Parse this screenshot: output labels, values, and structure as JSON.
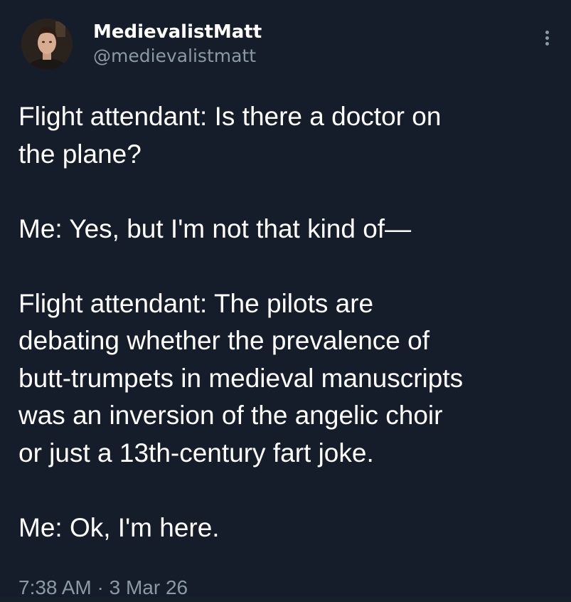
{
  "author": {
    "display_name": "MedievalistMatt",
    "handle": "@medievalistmatt",
    "avatar_icon": "profile-photo"
  },
  "actions": {
    "more_icon": "vertical-ellipsis-icon"
  },
  "tweet": {
    "paragraphs": [
      {
        "lines": [
          "Flight attendant: Is there a doctor on",
          "the plane?"
        ]
      },
      {
        "lines": [
          "Me: Yes, but I'm not that kind of—"
        ]
      },
      {
        "lines": [
          "Flight attendant: The pilots are",
          "debating whether the prevalence of",
          "butt-trumpets in medieval manuscripts",
          "was an inversion of the angelic choir",
          "or just a 13th-century fart joke."
        ]
      },
      {
        "lines": [
          "Me: Ok, I'm here."
        ]
      }
    ],
    "time": "7:38 AM",
    "separator": "·",
    "date": "3 Mar 26"
  },
  "colors": {
    "background": "#161d2a",
    "text": "#ffffff",
    "secondary_text": "#8b98a5"
  }
}
